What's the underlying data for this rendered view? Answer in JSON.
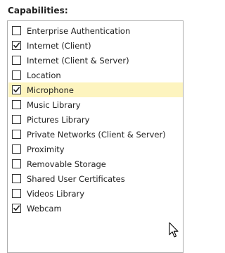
{
  "header": {
    "title": "Capabilities:"
  },
  "capabilities": [
    {
      "label": "Enterprise Authentication",
      "checked": false,
      "selected": false
    },
    {
      "label": "Internet (Client)",
      "checked": true,
      "selected": false
    },
    {
      "label": "Internet (Client & Server)",
      "checked": false,
      "selected": false
    },
    {
      "label": "Location",
      "checked": false,
      "selected": false
    },
    {
      "label": "Microphone",
      "checked": true,
      "selected": true
    },
    {
      "label": "Music Library",
      "checked": false,
      "selected": false
    },
    {
      "label": "Pictures Library",
      "checked": false,
      "selected": false
    },
    {
      "label": "Private Networks (Client & Server)",
      "checked": false,
      "selected": false
    },
    {
      "label": "Proximity",
      "checked": false,
      "selected": false
    },
    {
      "label": "Removable Storage",
      "checked": false,
      "selected": false
    },
    {
      "label": "Shared User Certificates",
      "checked": false,
      "selected": false
    },
    {
      "label": "Videos Library",
      "checked": false,
      "selected": false
    },
    {
      "label": "Webcam",
      "checked": true,
      "selected": false
    }
  ],
  "colors": {
    "selection_highlight": "#fdf4bf",
    "border": "#adadad",
    "checkmark": "#1e1e1e"
  },
  "icons": {
    "checkmark": "checkmark-icon",
    "cursor": "mouse-pointer-icon"
  }
}
